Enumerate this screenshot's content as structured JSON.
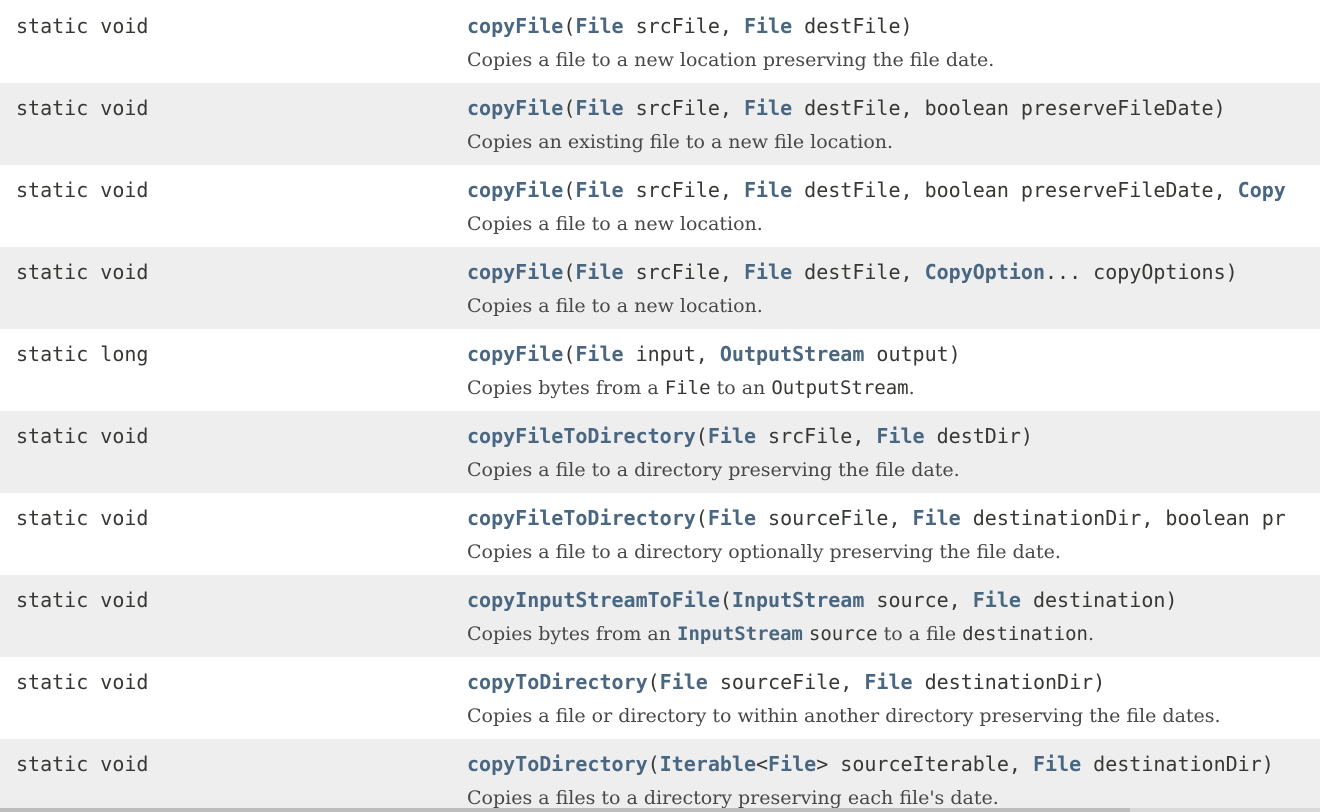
{
  "rows": [
    {
      "modifier": "static void",
      "signature": [
        {
          "t": "copyFile",
          "k": "method"
        },
        {
          "t": "(",
          "k": "text"
        },
        {
          "t": "File",
          "k": "type"
        },
        {
          "t": " srcFile, ",
          "k": "text"
        },
        {
          "t": "File",
          "k": "type"
        },
        {
          "t": " destFile)",
          "k": "text"
        }
      ],
      "description": [
        {
          "t": "Copies a file to a new location preserving the file date.",
          "k": "text"
        }
      ]
    },
    {
      "modifier": "static void",
      "signature": [
        {
          "t": "copyFile",
          "k": "method"
        },
        {
          "t": "(",
          "k": "text"
        },
        {
          "t": "File",
          "k": "type"
        },
        {
          "t": " srcFile, ",
          "k": "text"
        },
        {
          "t": "File",
          "k": "type"
        },
        {
          "t": " destFile, boolean preserveFileDate)",
          "k": "text"
        }
      ],
      "description": [
        {
          "t": "Copies an existing file to a new file location.",
          "k": "text"
        }
      ]
    },
    {
      "modifier": "static void",
      "signature": [
        {
          "t": "copyFile",
          "k": "method"
        },
        {
          "t": "(",
          "k": "text"
        },
        {
          "t": "File",
          "k": "type"
        },
        {
          "t": " srcFile, ",
          "k": "text"
        },
        {
          "t": "File",
          "k": "type"
        },
        {
          "t": " destFile, boolean preserveFileDate, ",
          "k": "text"
        },
        {
          "t": "Copy",
          "k": "type"
        }
      ],
      "description": [
        {
          "t": "Copies a file to a new location.",
          "k": "text"
        }
      ]
    },
    {
      "modifier": "static void",
      "signature": [
        {
          "t": "copyFile",
          "k": "method"
        },
        {
          "t": "(",
          "k": "text"
        },
        {
          "t": "File",
          "k": "type"
        },
        {
          "t": " srcFile, ",
          "k": "text"
        },
        {
          "t": "File",
          "k": "type"
        },
        {
          "t": " destFile, ",
          "k": "text"
        },
        {
          "t": "CopyOption",
          "k": "type"
        },
        {
          "t": "... copyOptions)",
          "k": "text"
        }
      ],
      "description": [
        {
          "t": "Copies a file to a new location.",
          "k": "text"
        }
      ]
    },
    {
      "modifier": "static long",
      "signature": [
        {
          "t": "copyFile",
          "k": "method"
        },
        {
          "t": "(",
          "k": "text"
        },
        {
          "t": "File",
          "k": "type"
        },
        {
          "t": " input, ",
          "k": "text"
        },
        {
          "t": "OutputStream",
          "k": "type"
        },
        {
          "t": " output)",
          "k": "text"
        }
      ],
      "description": [
        {
          "t": "Copies bytes from a ",
          "k": "text"
        },
        {
          "t": "File",
          "k": "code"
        },
        {
          "t": " to an ",
          "k": "text"
        },
        {
          "t": "OutputStream",
          "k": "code"
        },
        {
          "t": ".",
          "k": "text"
        }
      ]
    },
    {
      "modifier": "static void",
      "signature": [
        {
          "t": "copyFileToDirectory",
          "k": "method"
        },
        {
          "t": "(",
          "k": "text"
        },
        {
          "t": "File",
          "k": "type"
        },
        {
          "t": " srcFile, ",
          "k": "text"
        },
        {
          "t": "File",
          "k": "type"
        },
        {
          "t": " destDir)",
          "k": "text"
        }
      ],
      "description": [
        {
          "t": "Copies a file to a directory preserving the file date.",
          "k": "text"
        }
      ]
    },
    {
      "modifier": "static void",
      "signature": [
        {
          "t": "copyFileToDirectory",
          "k": "method"
        },
        {
          "t": "(",
          "k": "text"
        },
        {
          "t": "File",
          "k": "type"
        },
        {
          "t": " sourceFile, ",
          "k": "text"
        },
        {
          "t": "File",
          "k": "type"
        },
        {
          "t": " destinationDir, boolean pr",
          "k": "text"
        }
      ],
      "description": [
        {
          "t": "Copies a file to a directory optionally preserving the file date.",
          "k": "text"
        }
      ]
    },
    {
      "modifier": "static void",
      "signature": [
        {
          "t": "copyInputStreamToFile",
          "k": "method"
        },
        {
          "t": "(",
          "k": "text"
        },
        {
          "t": "InputStream",
          "k": "type"
        },
        {
          "t": " source, ",
          "k": "text"
        },
        {
          "t": "File",
          "k": "type"
        },
        {
          "t": " destination)",
          "k": "text"
        }
      ],
      "description": [
        {
          "t": "Copies bytes from an ",
          "k": "text"
        },
        {
          "t": "InputStream",
          "k": "codelink"
        },
        {
          "t": " ",
          "k": "text"
        },
        {
          "t": "source",
          "k": "code"
        },
        {
          "t": " to a file ",
          "k": "text"
        },
        {
          "t": "destination",
          "k": "code"
        },
        {
          "t": ".",
          "k": "text"
        }
      ]
    },
    {
      "modifier": "static void",
      "signature": [
        {
          "t": "copyToDirectory",
          "k": "method"
        },
        {
          "t": "(",
          "k": "text"
        },
        {
          "t": "File",
          "k": "type"
        },
        {
          "t": " sourceFile, ",
          "k": "text"
        },
        {
          "t": "File",
          "k": "type"
        },
        {
          "t": " destinationDir)",
          "k": "text"
        }
      ],
      "description": [
        {
          "t": "Copies a file or directory to within another directory preserving the file dates.",
          "k": "text"
        }
      ]
    },
    {
      "modifier": "static void",
      "signature": [
        {
          "t": "copyToDirectory",
          "k": "method"
        },
        {
          "t": "(",
          "k": "text"
        },
        {
          "t": "Iterable",
          "k": "type"
        },
        {
          "t": "<",
          "k": "text"
        },
        {
          "t": "File",
          "k": "type"
        },
        {
          "t": "> sourceIterable, ",
          "k": "text"
        },
        {
          "t": "File",
          "k": "type"
        },
        {
          "t": " destinationDir)",
          "k": "text"
        }
      ],
      "description": [
        {
          "t": "Copies a files to a directory preserving each file's date.",
          "k": "text"
        }
      ]
    }
  ],
  "colors": {
    "link": "#4a6782",
    "text": "#353833",
    "row_alt": "#eeeeee"
  }
}
